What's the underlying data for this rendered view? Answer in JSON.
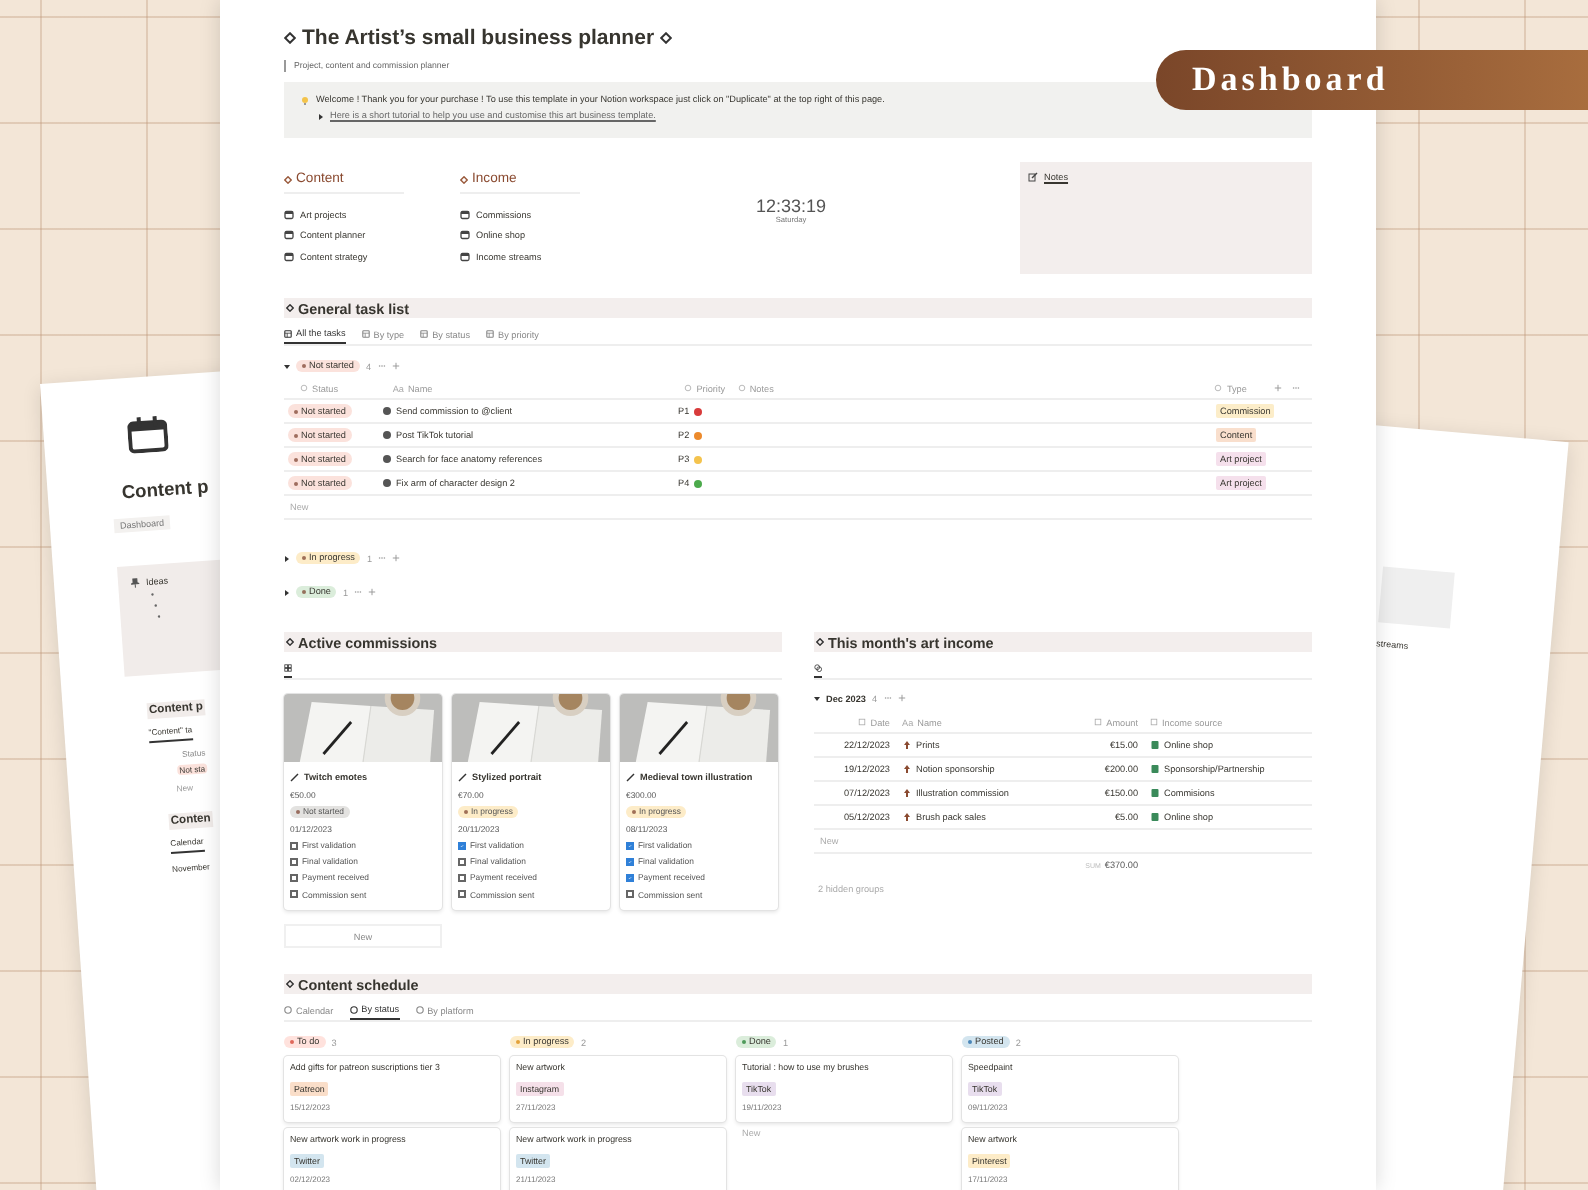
{
  "banner": {
    "label": "Dashboard"
  },
  "left_page": {
    "title": "Content p",
    "breadcrumb": "Dashboard",
    "callout": {
      "title": "Ideas"
    },
    "sections": [
      {
        "title": "Content p",
        "lines": [
          {
            "kind": "view",
            "text": "\"Content\" ta"
          },
          {
            "kind": "header",
            "text": "Status"
          },
          {
            "kind": "tag",
            "text": "Not sta"
          },
          {
            "kind": "add",
            "text": "New"
          }
        ]
      },
      {
        "title": "Conten",
        "lines": [
          {
            "kind": "view",
            "text": "Calendar"
          },
          {
            "kind": "text",
            "text": "November"
          }
        ]
      }
    ]
  },
  "right_page": {
    "text": "streams"
  },
  "page": {
    "title": "The Artist’s small business planner",
    "subtitle": "Project, content and commission planner",
    "callout": {
      "text": "Welcome ! Thank you for your purchase ! To use this template in your Notion workspace just click on \"Duplicate\" at the top right of this page.",
      "toggle": {
        "text": "Here is a short tutorial to help you use and customise this art business template.",
        "expanded": false
      }
    },
    "nav": [
      {
        "heading": "Content",
        "items": [
          "Art projects",
          "Content planner",
          "Content strategy"
        ]
      },
      {
        "heading": "Income",
        "items": [
          "Commissions",
          "Online shop",
          "Income streams"
        ]
      }
    ],
    "clock": {
      "time": "12:33:19",
      "day": "Saturday"
    },
    "notes": {
      "label": "Notes"
    },
    "task_list": {
      "title": "General task list",
      "views": [
        {
          "label": "All the tasks",
          "selected": true
        },
        {
          "label": "By type",
          "selected": false
        },
        {
          "label": "By status",
          "selected": false
        },
        {
          "label": "By priority",
          "selected": false
        }
      ],
      "columns": [
        {
          "label": "Status"
        },
        {
          "glyph": "Aa",
          "label": "Name"
        },
        {
          "label": "Priority"
        },
        {
          "label": "Notes"
        },
        {
          "label": "Type"
        }
      ],
      "groups": [
        {
          "label": "Not started",
          "count": "4",
          "color": "#fbe2dc",
          "expanded": true,
          "new_label": "New",
          "rows": [
            {
              "status": "Not started",
              "name": "Send commission to @client",
              "priority": {
                "label": "P1",
                "color": "#d83b3b"
              },
              "type": {
                "label": "Commission",
                "color": "#fcedc9"
              }
            },
            {
              "status": "Not started",
              "name": "Post TikTok tutorial",
              "priority": {
                "label": "P2",
                "color": "#ec8a2c"
              },
              "type": {
                "label": "Content",
                "color": "#f9dfcd"
              }
            },
            {
              "status": "Not started",
              "name": "Search for face anatomy references",
              "priority": {
                "label": "P3",
                "color": "#f4c34d"
              },
              "type": {
                "label": "Art project",
                "color": "#f5e0ec"
              }
            },
            {
              "status": "Not started",
              "name": "Fix arm of character design 2",
              "priority": {
                "label": "P4",
                "color": "#4caa4c"
              },
              "type": {
                "label": "Art project",
                "color": "#f5e0ec"
              }
            }
          ]
        },
        {
          "label": "In progress",
          "count": "1",
          "color": "#fdecc8",
          "expanded": false
        },
        {
          "label": "Done",
          "count": "1",
          "color": "#dbeddb",
          "expanded": false
        }
      ]
    },
    "commissions": {
      "title": "Active commissions",
      "new_label": "New",
      "cards": [
        {
          "title": "Twitch emotes",
          "price": "€50.00",
          "status": {
            "label": "Not started",
            "color": "#e3e2e0"
          },
          "date": "01/12/2023",
          "checklist": [
            {
              "label": "First validation",
              "checked": false
            },
            {
              "label": "Final validation",
              "checked": false
            },
            {
              "label": "Payment received",
              "checked": false
            },
            {
              "label": "Commission sent",
              "checked": false
            }
          ]
        },
        {
          "title": "Stylized portrait",
          "price": "€70.00",
          "status": {
            "label": "In progress",
            "color": "#fdecc8"
          },
          "date": "20/11/2023",
          "checklist": [
            {
              "label": "First validation",
              "checked": true
            },
            {
              "label": "Final validation",
              "checked": false
            },
            {
              "label": "Payment received",
              "checked": false
            },
            {
              "label": "Commission sent",
              "checked": false
            }
          ]
        },
        {
          "title": "Medieval town illustration",
          "price": "€300.00",
          "status": {
            "label": "In progress",
            "color": "#fdecc8"
          },
          "date": "08/11/2023",
          "checklist": [
            {
              "label": "First validation",
              "checked": true
            },
            {
              "label": "Final validation",
              "checked": true
            },
            {
              "label": "Payment received",
              "checked": true
            },
            {
              "label": "Commission sent",
              "checked": false
            }
          ]
        }
      ]
    },
    "income": {
      "title": "This month's art income",
      "group": {
        "label": "Dec 2023",
        "count": "4",
        "expanded": true
      },
      "columns": [
        {
          "label": "Date"
        },
        {
          "glyph": "Aa",
          "label": "Name"
        },
        {
          "label": "Amount"
        },
        {
          "label": "Income source"
        }
      ],
      "rows": [
        {
          "date": "22/12/2023",
          "name": "Prints",
          "amount": "€15.00",
          "source": "Online shop"
        },
        {
          "date": "19/12/2023",
          "name": "Notion sponsorship",
          "amount": "€200.00",
          "source": "Sponsorship/Partnership"
        },
        {
          "date": "07/12/2023",
          "name": "Illustration commission",
          "amount": "€150.00",
          "source": "Commisions"
        },
        {
          "date": "05/12/2023",
          "name": "Brush pack sales",
          "amount": "€5.00",
          "source": "Online shop"
        }
      ],
      "new_label": "New",
      "sum_label": "SUM",
      "sum": "€370.00",
      "hidden": "2 hidden groups"
    },
    "schedule": {
      "title": "Content schedule",
      "views": [
        {
          "label": "Calendar",
          "selected": false
        },
        {
          "label": "By status",
          "selected": true
        },
        {
          "label": "By platform",
          "selected": false
        }
      ],
      "columns": [
        {
          "label": "To do",
          "count": "3",
          "color": "#ffe2dd",
          "dot": {
            "color": "#e0685b"
          },
          "cards": [
            {
              "title": "Add gifts for patreon suscriptions tier 3",
              "tag": {
                "label": "Patreon",
                "color": "#fadec9"
              },
              "date": "15/12/2023"
            },
            {
              "title": "New artwork work in progress",
              "tag": {
                "label": "Twitter",
                "color": "#d3e5ef"
              },
              "date": "02/12/2023"
            }
          ]
        },
        {
          "label": "In progress",
          "count": "2",
          "color": "#fdecc8",
          "dot": {
            "color": "#e3a23a"
          },
          "cards": [
            {
              "title": "New artwork",
              "tag": {
                "label": "Instagram",
                "color": "#f5e0e9"
              },
              "date": "27/11/2023"
            },
            {
              "title": "New artwork work in progress",
              "tag": {
                "label": "Twitter",
                "color": "#d3e5ef"
              },
              "date": "21/11/2023"
            }
          ]
        },
        {
          "label": "Done",
          "count": "1",
          "color": "#dbeddb",
          "dot": {
            "color": "#4f9a5a"
          },
          "new_label": "New",
          "cards": [
            {
              "title": "Tutorial : how to use my brushes",
              "tag": {
                "label": "TikTok",
                "color": "#e8deee"
              },
              "date": "19/11/2023"
            }
          ]
        },
        {
          "label": "Posted",
          "count": "2",
          "color": "#d3e5ef",
          "dot": {
            "color": "#4a86b8"
          },
          "cards": [
            {
              "title": "Speedpaint",
              "tag": {
                "label": "TikTok",
                "color": "#e8deee"
              },
              "date": "09/11/2023"
            },
            {
              "title": "New artwork",
              "tag": {
                "label": "Pinterest",
                "color": "#fdecc8"
              },
              "date": "17/11/2023"
            }
          ]
        }
      ]
    }
  }
}
